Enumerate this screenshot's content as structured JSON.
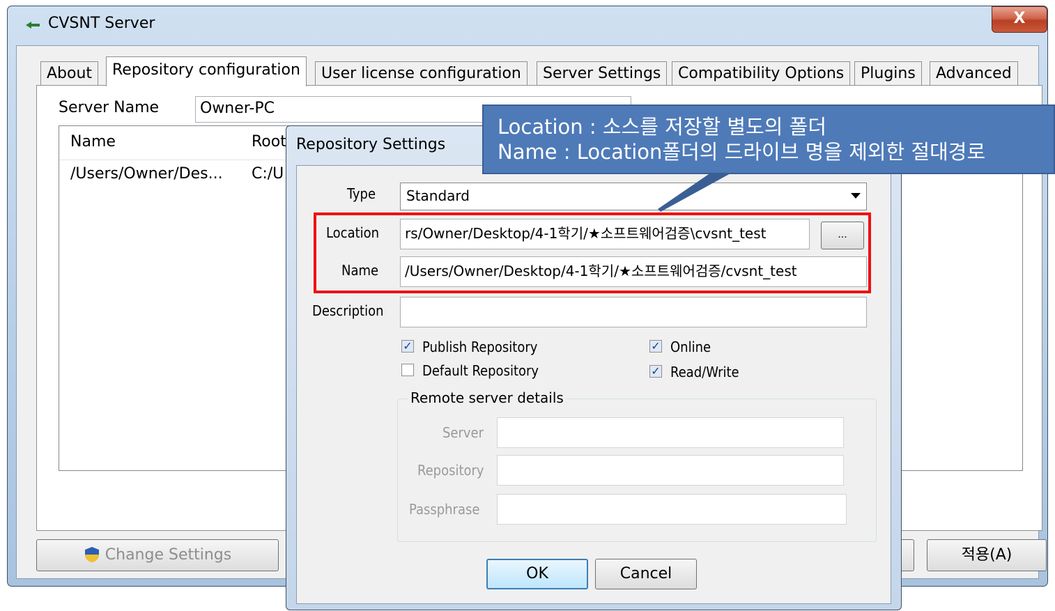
{
  "window": {
    "title": "CVSNT Server",
    "close_label": "X"
  },
  "tabs": [
    {
      "label": "About"
    },
    {
      "label": "Repository configuration"
    },
    {
      "label": "User license configuration"
    },
    {
      "label": "Server Settings"
    },
    {
      "label": "Compatibility Options"
    },
    {
      "label": "Plugins"
    },
    {
      "label": "Advanced"
    }
  ],
  "repo_config": {
    "server_name_label": "Server Name",
    "server_name_value": "Owner-PC",
    "columns": [
      "Name",
      "Root"
    ],
    "rows": [
      {
        "name": "/Users/Owner/Des...",
        "root": "C:/U"
      }
    ]
  },
  "bottom_buttons": {
    "change_settings": "Change Settings",
    "apply": "적용(A)"
  },
  "dialog": {
    "title": "Repository Settings",
    "type_label": "Type",
    "type_value": "Standard",
    "location_label": "Location",
    "location_value": "rs/Owner/Desktop/4-1학기/★소프트웨어검증\\cvsnt_test",
    "browse_label": "...",
    "name_label": "Name",
    "name_value": "/Users/Owner/Desktop/4-1학기/★소프트웨어검증/cvsnt_test",
    "description_label": "Description",
    "description_value": "",
    "checkboxes": {
      "publish": {
        "label": "Publish Repository",
        "checked": true
      },
      "default": {
        "label": "Default Repository",
        "checked": false
      },
      "online": {
        "label": "Online",
        "checked": true
      },
      "readwrite": {
        "label": "Read/Write",
        "checked": true
      }
    },
    "remote_group_title": "Remote server details",
    "server_label": "Server",
    "repository_label": "Repository",
    "passphrase_label": "Passphrase",
    "ok_label": "OK",
    "cancel_label": "Cancel"
  },
  "callout": {
    "line1": "Location : 소스를 저장할 별도의 폴더",
    "line2": "Name : Location폴더의 드라이브 명을 제외한 절대경로"
  },
  "colors": {
    "callout_bg": "#4e7ab8",
    "highlight_border": "#ee1111"
  }
}
